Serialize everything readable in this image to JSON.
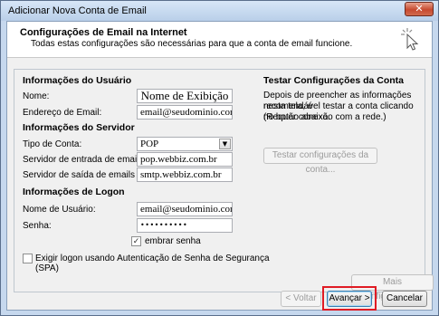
{
  "window": {
    "title": "Adicionar Nova Conta de Email",
    "close_glyph": "✕"
  },
  "header": {
    "title": "Configurações de Email na Internet",
    "subtitle": "Todas estas configurações são necessárias para que a conta de email funcione."
  },
  "user_info": {
    "heading": "Informações do Usuário",
    "name_label": "Nome:",
    "name_value": "Nome de Exibição",
    "email_label": "Endereço de Email:",
    "email_value": "email@seudominio.com.br"
  },
  "server_info": {
    "heading": "Informações do Servidor",
    "account_type_label": "Tipo de Conta:",
    "account_type_value": "POP",
    "incoming_label": "Servidor de entrada de emails:",
    "incoming_value": "pop.webbiz.com.br",
    "outgoing_label": "Servidor de saída de emails (SMTP):",
    "outgoing_value": "smtp.webbiz.com.br"
  },
  "logon_info": {
    "heading": "Informações de Logon",
    "username_label": "Nome de Usuário:",
    "username_value": "email@seudominio.com.br",
    "password_label": "Senha:",
    "password_value": "••••••••••",
    "remember_label": "embrar senha",
    "remember_checked": true,
    "spa_label_line1": "Exigir logon usando Autenticação de Senha de Segurança",
    "spa_label_line2": "(SPA)",
    "spa_checked": false
  },
  "test_settings": {
    "heading": "Testar Configurações da Conta",
    "desc_line1": "Depois de preencher as informações nesta tela, é",
    "desc_line2": "recomendável testar a conta clicando no botão abaixo.",
    "desc_line3": "(Requer conexão com a rede.)",
    "test_button": "Testar configurações da conta..."
  },
  "buttons": {
    "more_settings": "Mais Configurações...",
    "back": "< Voltar",
    "next": "Avançar >",
    "cancel": "Cancelar"
  },
  "colors": {
    "highlight": "#e01b24"
  }
}
